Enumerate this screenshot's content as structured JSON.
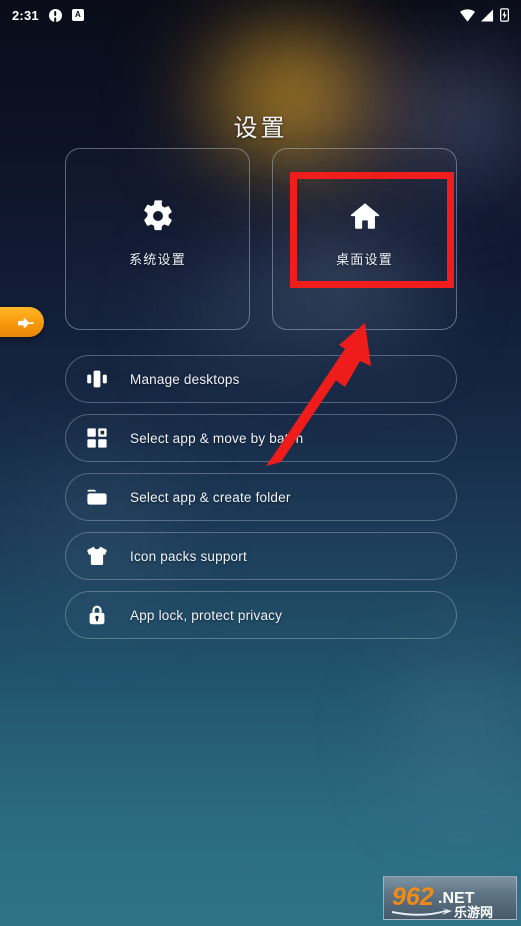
{
  "statusbar": {
    "time": "2:31",
    "alert_icon": "alert-circle-icon",
    "a_badge_icon": "a-badge-icon",
    "a_badge_text": "A",
    "wifi_icon": "wifi-icon",
    "signal_icon": "cellular-signal-icon",
    "battery_icon": "battery-charging-icon"
  },
  "header": {
    "title": "设置"
  },
  "cards": [
    {
      "label": "系统设置",
      "icon": "gear-icon",
      "highlighted": false
    },
    {
      "label": "桌面设置",
      "icon": "home-icon",
      "highlighted": true
    }
  ],
  "list": [
    {
      "label": "Manage desktops",
      "icon": "carousel-cards-icon"
    },
    {
      "label": "Select app & move by batch",
      "icon": "grid-squares-icon"
    },
    {
      "label": "Select app & create folder",
      "icon": "folder-icon"
    },
    {
      "label": "Icon packs support",
      "icon": "tshirt-icon"
    },
    {
      "label": "App lock, protect privacy",
      "icon": "lock-icon"
    }
  ],
  "side_tab": {
    "icon": "pointing-hand-icon"
  },
  "annotations": {
    "highlight_color": "#f01d1d",
    "arrow_color": "#ef1c1c",
    "arrow_from": "267,465",
    "arrow_to": "363,325"
  },
  "watermark": {
    "number": "962",
    "tld": ".NET",
    "chinese": "乐游网"
  },
  "theme": {
    "accent_orange": "#f79a0c",
    "text_primary": "#f0f2f6",
    "bg_top": "#0a0c18",
    "bg_bottom": "#2f7386"
  }
}
